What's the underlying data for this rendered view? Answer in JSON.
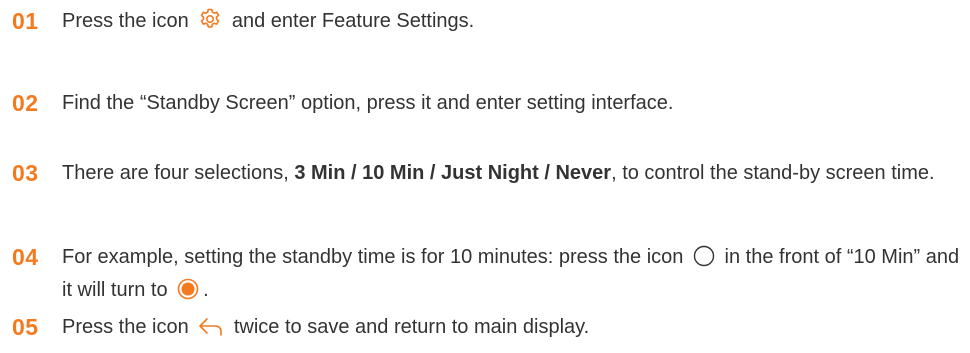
{
  "colors": {
    "accent": "#f47a20",
    "text": "#333333"
  },
  "steps": [
    {
      "number": "01",
      "before": "Press the icon",
      "icon": "gear-icon",
      "after": "and enter Feature Settings."
    },
    {
      "number": "02",
      "text": "Find the “Standby Screen” option, press it and enter setting interface."
    },
    {
      "number": "03",
      "before": "There are four selections,",
      "bold": "3 Min / 10 Min / Just Night / Never",
      "after": ", to control the stand-by screen time."
    },
    {
      "number": "04",
      "before": "For example, setting the standby time is for 10 minutes: press the icon",
      "icon": "radio-empty-icon",
      "middle": "in the front of “10 Min” and it will turn to",
      "icon2": "radio-selected-icon",
      "after": "."
    },
    {
      "number": "05",
      "before": "Press the icon",
      "icon": "back-arrow-icon",
      "after": "twice to save and return to main display."
    }
  ]
}
